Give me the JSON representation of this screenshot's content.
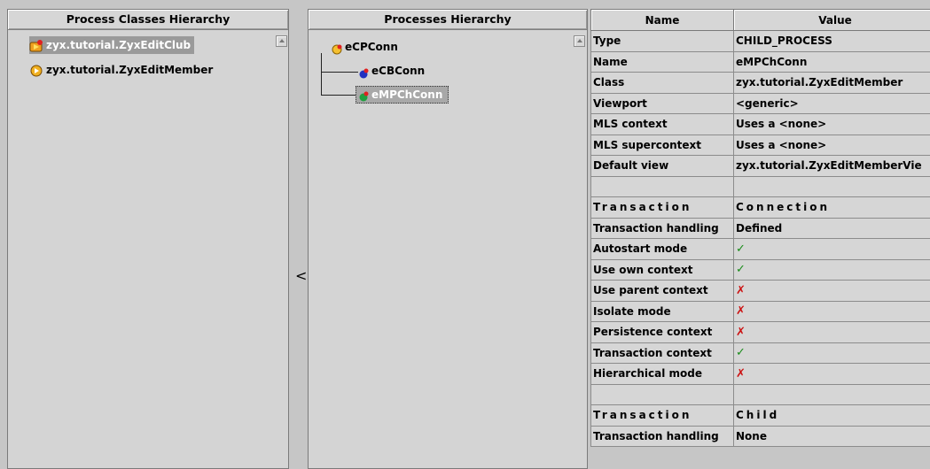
{
  "left_pane": {
    "header": "Process Classes Hierarchy",
    "items": [
      {
        "label": "zyx.tutorial.ZyxEditClub",
        "selected": true
      },
      {
        "label": "zyx.tutorial.ZyxEditMember",
        "selected": false
      }
    ]
  },
  "splitter": {
    "arrow": "<"
  },
  "middle_pane": {
    "header": "Processes Hierarchy",
    "root": "eCPConn",
    "children": [
      "eCBConn",
      "eMPChConn"
    ]
  },
  "props": {
    "header_name": "Name",
    "header_value": "Value",
    "rows": [
      {
        "name": "Type",
        "value": "CHILD_PROCESS"
      },
      {
        "name": "Name",
        "value": "eMPChConn"
      },
      {
        "name": "Class",
        "value": "zyx.tutorial.ZyxEditMember"
      },
      {
        "name": "Viewport",
        "value": "<generic>"
      },
      {
        "name": "MLS context",
        "value": "Uses a <none>"
      },
      {
        "name": "MLS supercontext",
        "value": "Uses a <none>"
      },
      {
        "name": "Default view",
        "value": "zyx.tutorial.ZyxEditMemberVie"
      },
      {
        "name": "",
        "value": ""
      },
      {
        "name": "Transaction",
        "value": "Connection"
      },
      {
        "name": "Transaction handling",
        "value": "Defined"
      },
      {
        "name": "Autostart mode",
        "value": "✓"
      },
      {
        "name": "Use own context",
        "value": "✓"
      },
      {
        "name": "Use parent context",
        "value": "✗"
      },
      {
        "name": "Isolate mode",
        "value": "✗"
      },
      {
        "name": "Persistence context",
        "value": "✗"
      },
      {
        "name": "Transaction context",
        "value": "✓"
      },
      {
        "name": "Hierarchical mode",
        "value": "✗"
      },
      {
        "name": "",
        "value": ""
      },
      {
        "name": "Transaction",
        "value": "Child"
      },
      {
        "name": "Transaction handling",
        "value": "None"
      }
    ]
  },
  "colors": {
    "check": "#1a8c1a",
    "cross": "#cc1111"
  }
}
